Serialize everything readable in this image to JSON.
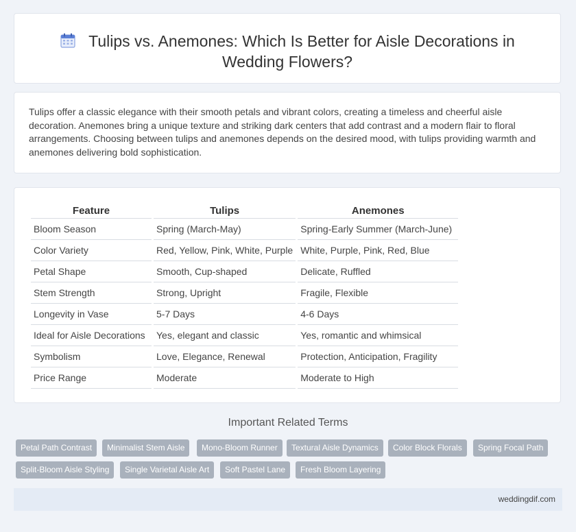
{
  "header": {
    "title": "Tulips vs. Anemones: Which Is Better for Aisle Decorations in Wedding Flowers?",
    "icon": "calendar-icon"
  },
  "intro": {
    "text": "Tulips offer a classic elegance with their smooth petals and vibrant colors, creating a timeless and cheerful aisle decoration. Anemones bring a unique texture and striking dark centers that add contrast and a modern flair to floral arrangements. Choosing between tulips and anemones depends on the desired mood, with tulips providing warmth and anemones delivering bold sophistication."
  },
  "table": {
    "headers": [
      "Feature",
      "Tulips",
      "Anemones"
    ],
    "rows": [
      [
        "Bloom Season",
        "Spring (March-May)",
        "Spring-Early Summer (March-June)"
      ],
      [
        "Color Variety",
        "Red, Yellow, Pink, White, Purple",
        "White, Purple, Pink, Red, Blue"
      ],
      [
        "Petal Shape",
        "Smooth, Cup-shaped",
        "Delicate, Ruffled"
      ],
      [
        "Stem Strength",
        "Strong, Upright",
        "Fragile, Flexible"
      ],
      [
        "Longevity in Vase",
        "5-7 Days",
        "4-6 Days"
      ],
      [
        "Ideal for Aisle Decorations",
        "Yes, elegant and classic",
        "Yes, romantic and whimsical"
      ],
      [
        "Symbolism",
        "Love, Elegance, Renewal",
        "Protection, Anticipation, Fragility"
      ],
      [
        "Price Range",
        "Moderate",
        "Moderate to High"
      ]
    ]
  },
  "related": {
    "title": "Important Related Terms",
    "tags": [
      "Petal Path Contrast",
      "Minimalist Stem Aisle",
      "Mono-Bloom Runner",
      "Textural Aisle Dynamics",
      "Color Block Florals",
      "Spring Focal Path",
      "Split-Bloom Aisle Styling",
      "Single Varietal Aisle Art",
      "Soft Pastel Lane",
      "Fresh Bloom Layering"
    ]
  },
  "footer": {
    "site": "weddingdif.com"
  },
  "colors": {
    "background": "#f0f3f8",
    "tag": "#a9b1bc",
    "footer": "#e4ebf5",
    "icon_accent": "#5b7fd6"
  }
}
